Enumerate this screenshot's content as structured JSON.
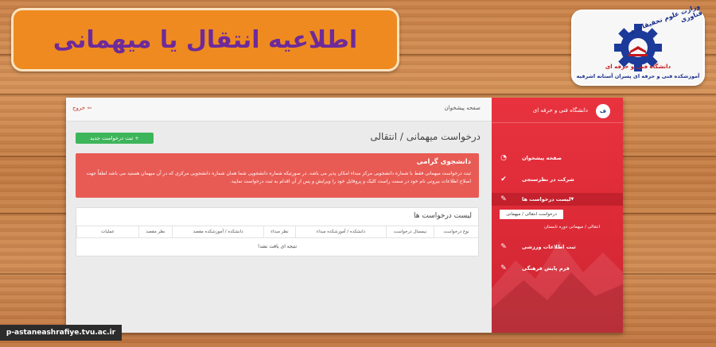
{
  "banner": {
    "title": "اطلاعیه انتقال یا میهمانی"
  },
  "logo": {
    "ministry": "وزارت علوم تحقیقات و فناوری",
    "line1": "دانشگاه فنی و حرفه ای",
    "line2": "آموزشکده فنی و حرفه ای پسران آستانه اشرفیه",
    "colors": {
      "gear": "#1b3a9a",
      "red": "#c6181b"
    }
  },
  "app": {
    "topbar": {
      "logout": "خروج",
      "home": "صفحه پیشخوان"
    },
    "page_title": "درخواست میهمانی / انتقالی",
    "new_request": "ثبت درخواست جدید",
    "alert": {
      "title": "دانشجوی گرامی",
      "text": "ثبت درخواست میهمانی فقط با شماره دانشجویی مرکز مبداء امکان پذیر می باشد. در صورتیکه شماره دانشجویی شما همان شماره دانشجویی مرکزی که در آن میهمان هستید می باشد لطفاً جهت اصلاح اطلاعات بیرونی نام خود در سمت راست کلیک و پروفایل خود را ویرایش و پس از آن اقدام به ثبت درخواست نمایید."
    },
    "list": {
      "title": "لیست درخواست ها",
      "columns": [
        "نوع درخواست",
        "نیمسال درخواست",
        "دانشکده / آموزشکده مبداء",
        "نظر مبداء",
        "دانشکده / آموزشکده مقصد",
        "نظر مقصد",
        "عملیات"
      ],
      "empty": "نتیجه ای یافت نشد!"
    },
    "sidebar": {
      "header": "دانشگاه فنی و حرفه ای",
      "logo_text": "ف",
      "items": [
        {
          "label": "صفحه پیشخوان",
          "icon": "dashboard-icon"
        },
        {
          "label": "شرکت در نظرسنجی",
          "icon": "check-icon"
        },
        {
          "label": "لیست درخواست ها",
          "icon": "edit-icon"
        },
        {
          "label": "ثبت اطلاعات ورزشی",
          "icon": "edit-icon"
        },
        {
          "label": "فرم پایش فرهنگی",
          "icon": "edit-icon"
        }
      ],
      "sub_items": [
        "درخواست انتقالی / میهمانی",
        "انتقالی / میهمانی دوره تابستان"
      ]
    }
  },
  "url_tag": "p-astaneashrafiye.tvu.ac.ir"
}
